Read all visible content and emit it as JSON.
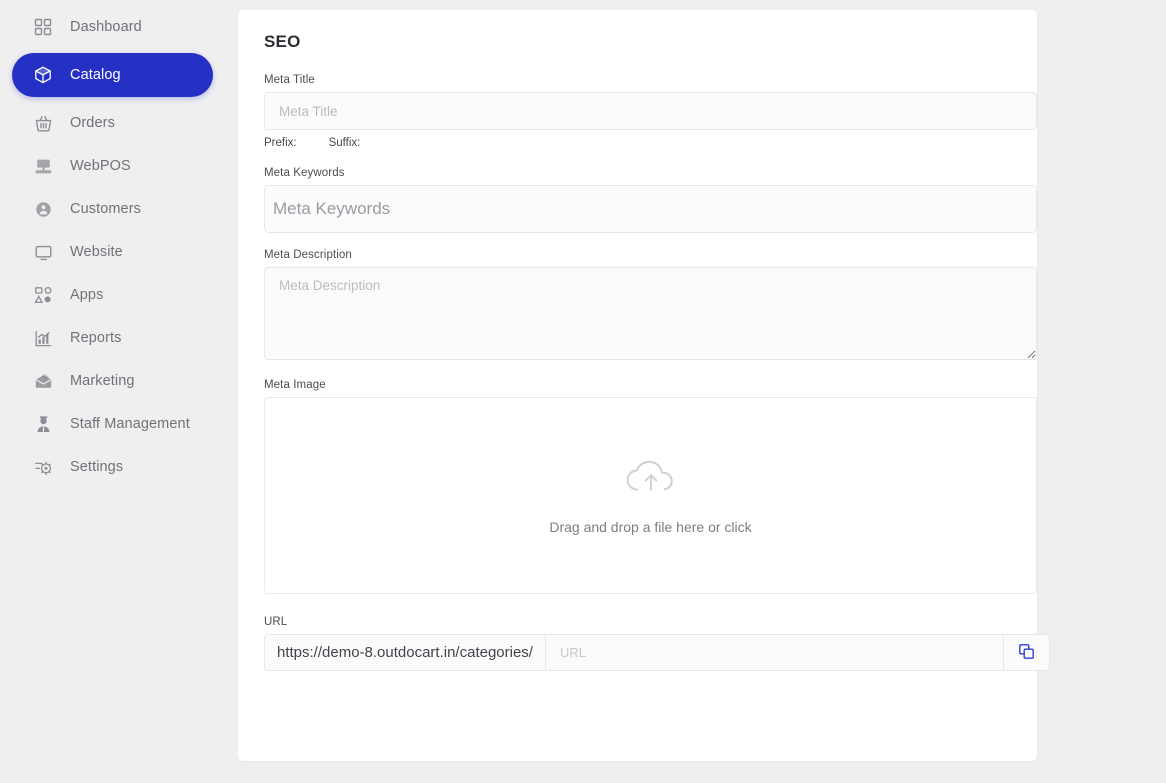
{
  "sidebar": {
    "items": [
      {
        "label": "Dashboard",
        "icon": "grid-icon",
        "active": false
      },
      {
        "label": "Catalog",
        "icon": "box-icon",
        "active": true
      },
      {
        "label": "Orders",
        "icon": "basket-icon",
        "active": false
      },
      {
        "label": "WebPOS",
        "icon": "pos-terminal-icon",
        "active": false
      },
      {
        "label": "Customers",
        "icon": "customers-icon",
        "active": false
      },
      {
        "label": "Website",
        "icon": "monitor-icon",
        "active": false
      },
      {
        "label": "Apps",
        "icon": "apps-icon",
        "active": false
      },
      {
        "label": "Reports",
        "icon": "chart-icon",
        "active": false
      },
      {
        "label": "Marketing",
        "icon": "envelope-icon",
        "active": false
      },
      {
        "label": "Staff Management",
        "icon": "person-icon",
        "active": false
      },
      {
        "label": "Settings",
        "icon": "gear-slider-icon",
        "active": false
      }
    ]
  },
  "card": {
    "title": "SEO",
    "meta_title": {
      "label": "Meta Title",
      "value": "",
      "placeholder": "Meta Title"
    },
    "affix": {
      "prefix_label": "Prefix:",
      "suffix_label": "Suffix:"
    },
    "meta_keywords": {
      "label": "Meta Keywords",
      "value": "",
      "placeholder": "Meta Keywords"
    },
    "meta_description": {
      "label": "Meta Description",
      "value": "",
      "placeholder": "Meta Description"
    },
    "meta_image": {
      "label": "Meta Image",
      "dropzone_text": "Drag and drop a file here or click",
      "icon": "cloud-upload-icon"
    },
    "url": {
      "label": "URL",
      "prefix": "https://demo-8.outdocart.in/categories/",
      "value": "",
      "placeholder": "URL",
      "copy_icon": "copy-icon"
    }
  },
  "colors": {
    "accent": "#2530c4",
    "page_bg": "#efeff0",
    "card_bg": "#ffffff",
    "copy_icon": "#2f3fcf"
  }
}
